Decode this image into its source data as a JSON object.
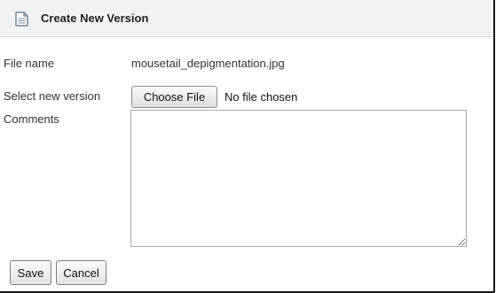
{
  "dialog": {
    "title": "Create New Version",
    "icon": "document-icon"
  },
  "form": {
    "file_name_label": "File name",
    "file_name_value": "mousetail_depigmentation.jpg",
    "select_version_label": "Select new version",
    "choose_file_label": "Choose File",
    "no_file_text": "No file chosen",
    "comments_label": "Comments",
    "comments_value": ""
  },
  "actions": {
    "save_label": "Save",
    "cancel_label": "Cancel"
  },
  "colors": {
    "title_bar_bg": "#f1f2f4",
    "frame_border": "#1a1a1a",
    "text": "#333333"
  }
}
